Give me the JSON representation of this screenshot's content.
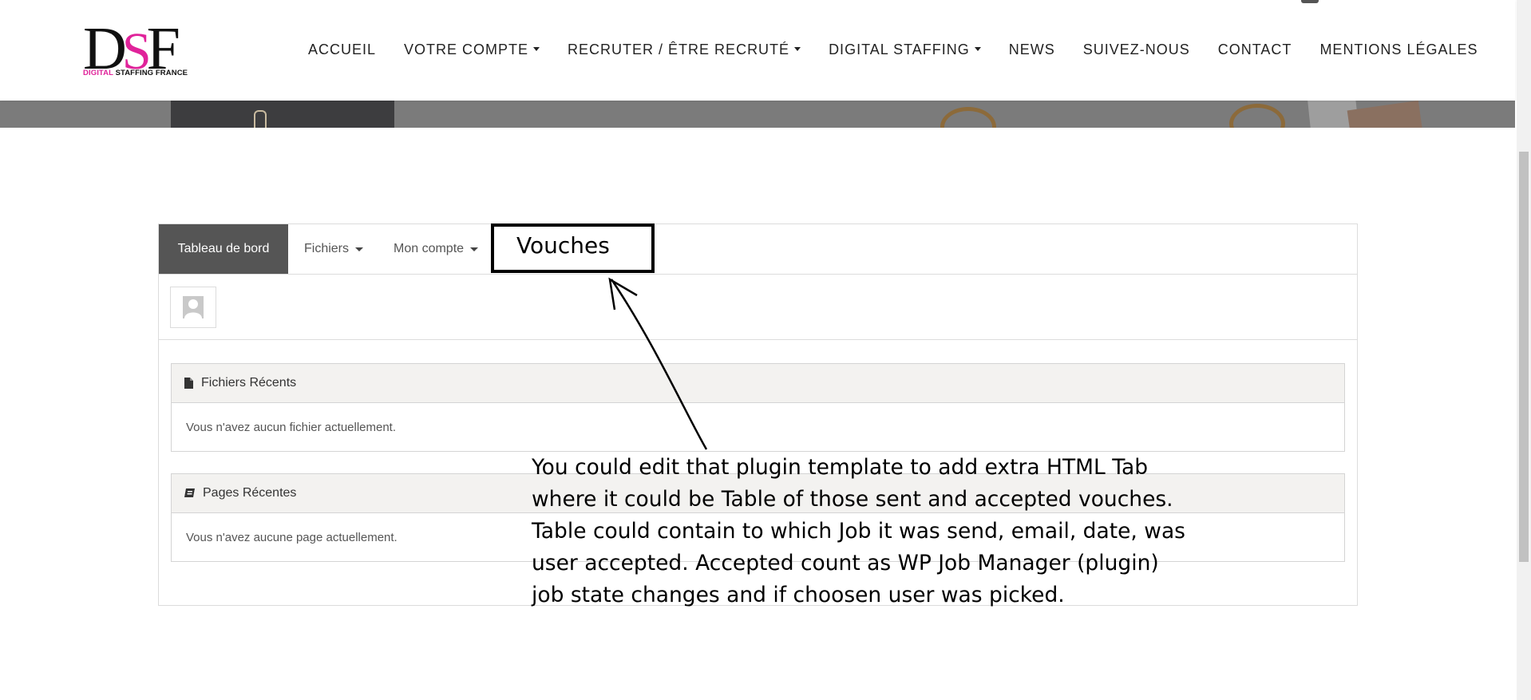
{
  "logo": {
    "mark_d": "D",
    "mark_s": "S",
    "mark_f": "F",
    "sub_pink": "DIGITAL",
    "sub_dark": "STAFFING FRANCE"
  },
  "nav": {
    "items": [
      {
        "label": "ACCUEIL",
        "dropdown": false
      },
      {
        "label": "VOTRE COMPTE",
        "dropdown": true
      },
      {
        "label": "RECRUTER / ÊTRE RECRUTÉ",
        "dropdown": true
      },
      {
        "label": "DIGITAL STAFFING",
        "dropdown": true
      },
      {
        "label": "NEWS",
        "dropdown": false
      },
      {
        "label": "SUIVEZ-NOUS",
        "dropdown": false
      },
      {
        "label": "CONTACT",
        "dropdown": false
      },
      {
        "label": "MENTIONS LÉGALES",
        "dropdown": false
      }
    ]
  },
  "tabs": {
    "dashboard": "Tableau de bord",
    "files": "Fichiers",
    "account": "Mon compte"
  },
  "recent_files": {
    "title": "Fichiers Récents",
    "empty": "Vous n'avez aucun fichier actuellement."
  },
  "recent_pages": {
    "title": "Pages Récentes",
    "empty": "Vous n'avez aucune page actuellement."
  },
  "annotation": {
    "tab_label": "Vouches",
    "note": "You could edit that plugin template to add extra HTML Tab\nwhere it could be Table of those sent and accepted vouches.\nTable could contain to which Job it was send, email, date, was\nuser accepted. Accepted count as WP Job Manager (plugin)\njob state changes and if choosen user was picked."
  },
  "colors": {
    "brand_pink": "#e0239a",
    "active_tab": "#555555",
    "panel_head": "#f3f2f0"
  }
}
